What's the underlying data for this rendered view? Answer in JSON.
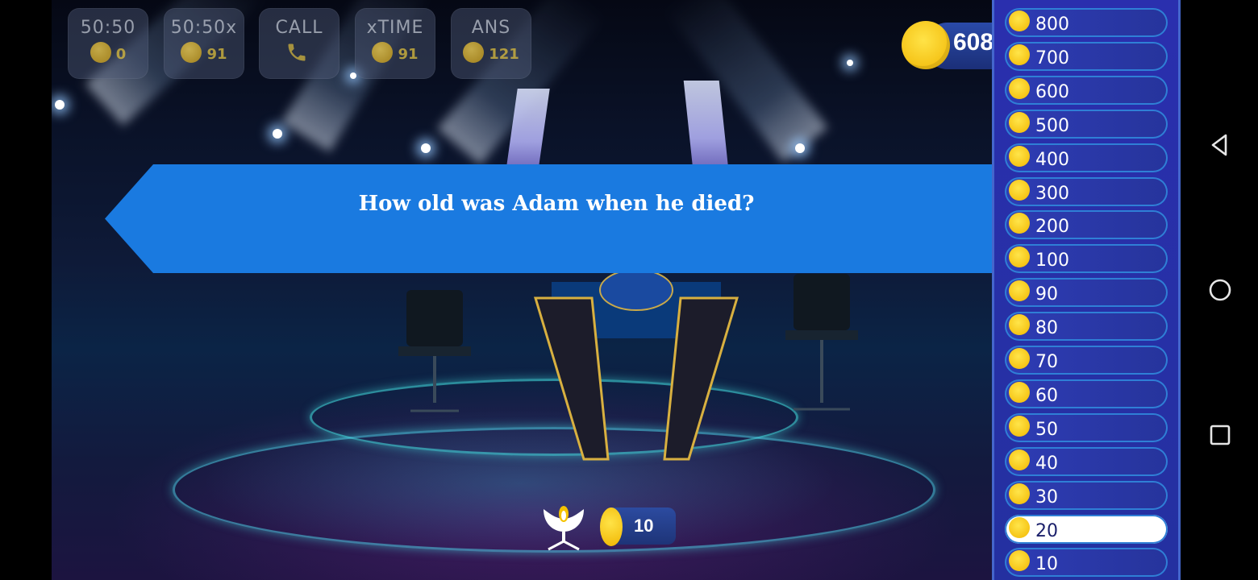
{
  "lifelines": [
    {
      "label": "50:50",
      "cost": "0",
      "icon": "coin-icon"
    },
    {
      "label": "50:50x",
      "cost": "91",
      "icon": "coin-icon"
    },
    {
      "label": "CALL",
      "cost": "",
      "icon": "phone-icon"
    },
    {
      "label": "xTIME",
      "cost": "91",
      "icon": "coin-icon"
    },
    {
      "label": "ANS",
      "cost": "121",
      "icon": "coin-icon"
    }
  ],
  "balance": {
    "value": "608"
  },
  "question": {
    "text": "How old was Adam when he died?"
  },
  "walk_away": {
    "value": "10"
  },
  "ladder": {
    "items": [
      {
        "amount": "800"
      },
      {
        "amount": "700"
      },
      {
        "amount": "600"
      },
      {
        "amount": "500"
      },
      {
        "amount": "400"
      },
      {
        "amount": "300"
      },
      {
        "amount": "200"
      },
      {
        "amount": "100"
      },
      {
        "amount": "90"
      },
      {
        "amount": "80"
      },
      {
        "amount": "70"
      },
      {
        "amount": "60"
      },
      {
        "amount": "50"
      },
      {
        "amount": "40"
      },
      {
        "amount": "30"
      },
      {
        "amount": "20"
      },
      {
        "amount": "10"
      }
    ],
    "current": "20"
  },
  "colors": {
    "banner": "#1a7ae0",
    "ladder": "#2a2fae",
    "coin": "#f2b700"
  }
}
